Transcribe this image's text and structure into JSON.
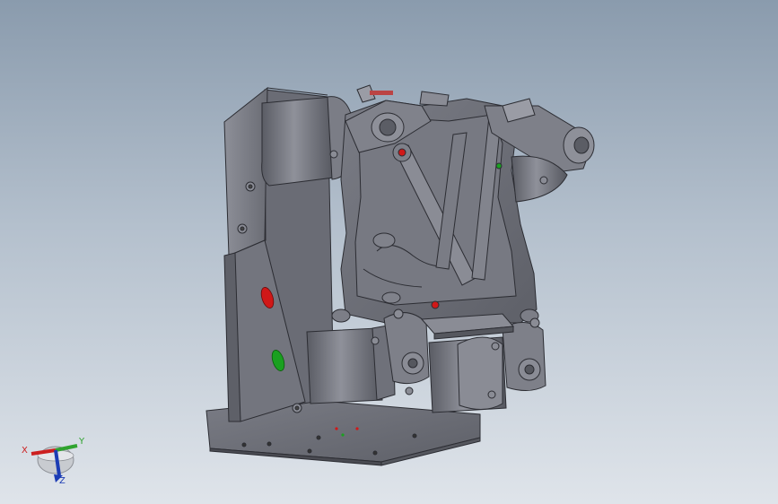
{
  "viewport": {
    "background_top": "#8a9bad",
    "background_bottom": "#dfe4ea"
  },
  "model": {
    "body_color": "#6e7079",
    "shadow_color": "#4f5058",
    "highlight_color": "#8a8c95",
    "edge_color": "#2c2d33",
    "marker_red": "#d01818",
    "marker_green": "#1aa020"
  },
  "triad": {
    "x_label": "X",
    "y_label": "Y",
    "z_label": "Z",
    "x_color": "#cc1f1f",
    "y_color": "#2fa32f",
    "z_color": "#1c3cb4"
  }
}
